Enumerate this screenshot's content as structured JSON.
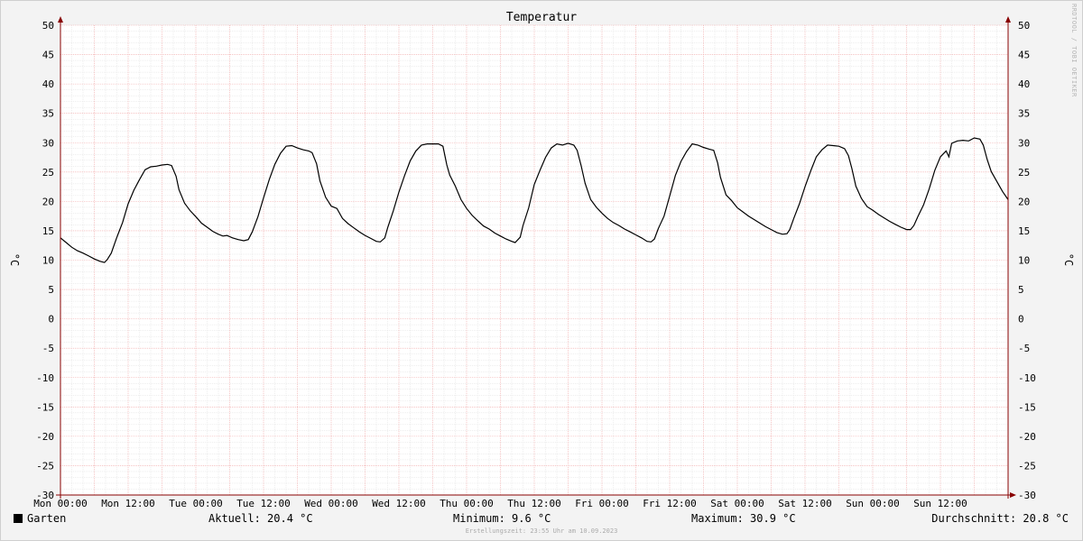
{
  "chart_data": {
    "type": "line",
    "title": "Temperatur",
    "ylabel": "°C",
    "ylim": [
      -30,
      50
    ],
    "yticks": [
      -30,
      -25,
      -20,
      -15,
      -10,
      -5,
      0,
      5,
      10,
      15,
      20,
      25,
      30,
      35,
      40,
      45,
      50
    ],
    "xlim_hours": [
      0,
      168
    ],
    "xticks": [
      {
        "hour": 0,
        "label": "Mon 00:00"
      },
      {
        "hour": 12,
        "label": "Mon 12:00"
      },
      {
        "hour": 24,
        "label": "Tue 00:00"
      },
      {
        "hour": 36,
        "label": "Tue 12:00"
      },
      {
        "hour": 48,
        "label": "Wed 00:00"
      },
      {
        "hour": 60,
        "label": "Wed 12:00"
      },
      {
        "hour": 72,
        "label": "Thu 00:00"
      },
      {
        "hour": 84,
        "label": "Thu 12:00"
      },
      {
        "hour": 96,
        "label": "Fri 00:00"
      },
      {
        "hour": 108,
        "label": "Fri 12:00"
      },
      {
        "hour": 120,
        "label": "Sat 00:00"
      },
      {
        "hour": 132,
        "label": "Sat 12:00"
      },
      {
        "hour": 144,
        "label": "Sun 00:00"
      },
      {
        "hour": 156,
        "label": "Sun 12:00"
      }
    ],
    "grid": true,
    "series": [
      {
        "name": "Garten",
        "color": "#000000",
        "points": [
          [
            0,
            13.8
          ],
          [
            1,
            13
          ],
          [
            2,
            12.2
          ],
          [
            3,
            11.6
          ],
          [
            4,
            11.2
          ],
          [
            5,
            10.7
          ],
          [
            6,
            10.2
          ],
          [
            7,
            9.8
          ],
          [
            7.8,
            9.6
          ],
          [
            8.3,
            10.1
          ],
          [
            9,
            11.2
          ],
          [
            10,
            13.9
          ],
          [
            11,
            16.4
          ],
          [
            12,
            19.6
          ],
          [
            13,
            21.9
          ],
          [
            14,
            23.7
          ],
          [
            15,
            25.4
          ],
          [
            16,
            25.9
          ],
          [
            17,
            26
          ],
          [
            18,
            26.2
          ],
          [
            19,
            26.3
          ],
          [
            19.7,
            26.1
          ],
          [
            20.5,
            24.3
          ],
          [
            21,
            22
          ],
          [
            22,
            19.7
          ],
          [
            23,
            18.4
          ],
          [
            24,
            17.4
          ],
          [
            25,
            16.3
          ],
          [
            26,
            15.6
          ],
          [
            27,
            14.9
          ],
          [
            28,
            14.4
          ],
          [
            28.8,
            14.1
          ],
          [
            29.5,
            14.2
          ],
          [
            30.5,
            13.8
          ],
          [
            31.5,
            13.5
          ],
          [
            32.5,
            13.3
          ],
          [
            33.3,
            13.5
          ],
          [
            34,
            14.8
          ],
          [
            35,
            17.4
          ],
          [
            36,
            20.6
          ],
          [
            37,
            23.7
          ],
          [
            38,
            26.3
          ],
          [
            39,
            28.2
          ],
          [
            40,
            29.4
          ],
          [
            41,
            29.5
          ],
          [
            42,
            29.1
          ],
          [
            43,
            28.8
          ],
          [
            44,
            28.6
          ],
          [
            44.6,
            28.3
          ],
          [
            45.4,
            26.4
          ],
          [
            46,
            23.5
          ],
          [
            47,
            20.7
          ],
          [
            48,
            19.2
          ],
          [
            49,
            18.8
          ],
          [
            50,
            17.1
          ],
          [
            51,
            16.2
          ],
          [
            52,
            15.5
          ],
          [
            53,
            14.8
          ],
          [
            54,
            14.2
          ],
          [
            55,
            13.7
          ],
          [
            56,
            13.2
          ],
          [
            56.7,
            13.1
          ],
          [
            57.5,
            13.8
          ],
          [
            58,
            15.5
          ],
          [
            59,
            18.4
          ],
          [
            60,
            21.6
          ],
          [
            61,
            24.4
          ],
          [
            62,
            26.9
          ],
          [
            63,
            28.6
          ],
          [
            64,
            29.6
          ],
          [
            65,
            29.8
          ],
          [
            66,
            29.8
          ],
          [
            67,
            29.8
          ],
          [
            67.8,
            29.4
          ],
          [
            68.5,
            26.2
          ],
          [
            69,
            24.5
          ],
          [
            70,
            22.6
          ],
          [
            71,
            20.3
          ],
          [
            72,
            18.8
          ],
          [
            73,
            17.6
          ],
          [
            74,
            16.7
          ],
          [
            75,
            15.8
          ],
          [
            76,
            15.3
          ],
          [
            77,
            14.6
          ],
          [
            78,
            14.1
          ],
          [
            79,
            13.6
          ],
          [
            80,
            13.2
          ],
          [
            80.6,
            13
          ],
          [
            81.5,
            13.9
          ],
          [
            82,
            15.9
          ],
          [
            83,
            18.9
          ],
          [
            84,
            22.9
          ],
          [
            85,
            25.3
          ],
          [
            86,
            27.5
          ],
          [
            87,
            29.1
          ],
          [
            88,
            29.8
          ],
          [
            89,
            29.6
          ],
          [
            90,
            29.9
          ],
          [
            91,
            29.6
          ],
          [
            91.6,
            28.7
          ],
          [
            92.3,
            26.1
          ],
          [
            93,
            23.1
          ],
          [
            94,
            20.3
          ],
          [
            95,
            19
          ],
          [
            96,
            18
          ],
          [
            97,
            17.1
          ],
          [
            98,
            16.4
          ],
          [
            99,
            15.9
          ],
          [
            100,
            15.3
          ],
          [
            101,
            14.8
          ],
          [
            102,
            14.3
          ],
          [
            103,
            13.8
          ],
          [
            104,
            13.2
          ],
          [
            104.7,
            13.1
          ],
          [
            105.3,
            13.6
          ],
          [
            106,
            15.4
          ],
          [
            107,
            17.5
          ],
          [
            108,
            20.9
          ],
          [
            109,
            24.4
          ],
          [
            110,
            26.8
          ],
          [
            111,
            28.5
          ],
          [
            112,
            29.8
          ],
          [
            113,
            29.6
          ],
          [
            114,
            29.2
          ],
          [
            115,
            28.9
          ],
          [
            115.8,
            28.7
          ],
          [
            116.5,
            26.6
          ],
          [
            117,
            24.1
          ],
          [
            118,
            21.1
          ],
          [
            119,
            20.1
          ],
          [
            120,
            18.9
          ],
          [
            121,
            18.2
          ],
          [
            122,
            17.5
          ],
          [
            123,
            16.9
          ],
          [
            124,
            16.3
          ],
          [
            125,
            15.7
          ],
          [
            126,
            15.2
          ],
          [
            127,
            14.7
          ],
          [
            128,
            14.4
          ],
          [
            128.8,
            14.5
          ],
          [
            129.3,
            15.2
          ],
          [
            130,
            17.1
          ],
          [
            131,
            19.6
          ],
          [
            132,
            22.5
          ],
          [
            133,
            25.2
          ],
          [
            134,
            27.6
          ],
          [
            135,
            28.8
          ],
          [
            136,
            29.6
          ],
          [
            137,
            29.5
          ],
          [
            138,
            29.4
          ],
          [
            139,
            29
          ],
          [
            139.7,
            27.8
          ],
          [
            140.3,
            25.6
          ],
          [
            141,
            22.6
          ],
          [
            142,
            20.5
          ],
          [
            143,
            19.1
          ],
          [
            144,
            18.5
          ],
          [
            145,
            17.8
          ],
          [
            146,
            17.2
          ],
          [
            147,
            16.6
          ],
          [
            148,
            16.1
          ],
          [
            149,
            15.6
          ],
          [
            150,
            15.2
          ],
          [
            150.7,
            15.2
          ],
          [
            151.3,
            15.9
          ],
          [
            152,
            17.4
          ],
          [
            153,
            19.4
          ],
          [
            154,
            22.1
          ],
          [
            155,
            25.3
          ],
          [
            156,
            27.6
          ],
          [
            157,
            28.6
          ],
          [
            157.5,
            27.6
          ],
          [
            158,
            29.9
          ],
          [
            159,
            30.3
          ],
          [
            160,
            30.4
          ],
          [
            161,
            30.3
          ],
          [
            162,
            30.8
          ],
          [
            163,
            30.6
          ],
          [
            163.6,
            29.6
          ],
          [
            164.3,
            27.1
          ],
          [
            165,
            25.1
          ],
          [
            166,
            23.4
          ],
          [
            167,
            21.7
          ],
          [
            168,
            20.3
          ]
        ]
      }
    ]
  },
  "legend": {
    "label": "Garten",
    "color": "#000000"
  },
  "stats": {
    "current": "Aktuell: 20.4 °C",
    "minimum": "Minimum: 9.6 °C",
    "maximum": "Maximum: 30.9 °C",
    "average": "Durchschnitt: 20.8 °C"
  },
  "footer": {
    "timestamp": "Erstellungszeit: 23:55 Uhr am 10.09.2023"
  },
  "watermark": "RRDTOOL / TOBI OETIKER",
  "colors": {
    "background": "#f3f3f3",
    "plot": "#ffffff",
    "grid_minor": "#dddddd",
    "grid_major": "#f0a0a0",
    "axis": "#880000"
  }
}
